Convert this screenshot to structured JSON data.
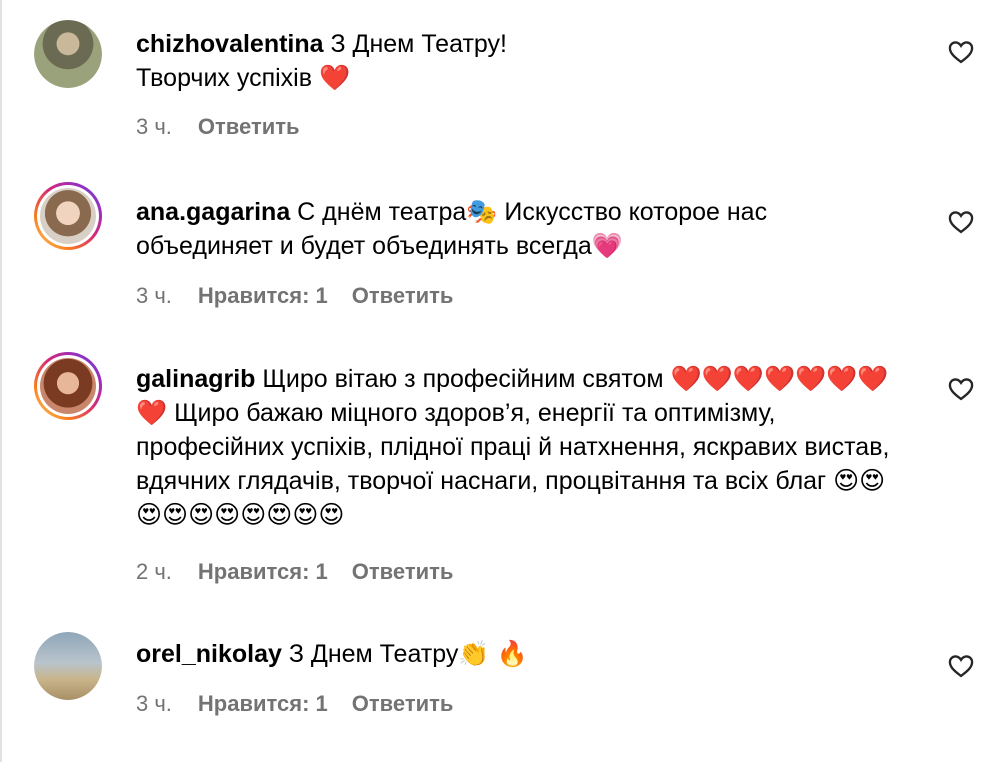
{
  "comments": [
    {
      "username": "chizhovalentina",
      "text": " З Днем Театру!\nТворчих успіхів ❤️",
      "time": "3 ч.",
      "likes": "",
      "reply": "Ответить",
      "avatar_ring": false
    },
    {
      "username": "ana.gagarina",
      "text": " С днём театра🎭 Искусство которое нас объединяет и будет объединять всегда💗",
      "time": "3 ч.",
      "likes": "Нравится: 1",
      "reply": "Ответить",
      "avatar_ring": true
    },
    {
      "username": "galinagrib",
      "text": " Щиро вітаю з професійним святом ❤️❤️❤️❤️❤️❤️❤️❤️ Щиро бажаю міцного здоров’я, енергії та оптимізму, професійних успіхів, плідної праці й натхнення, яскравих вистав, вдячних глядачів, творчої наснаги, процвітання та всіх благ 😍😍😍😍😍😍😍😍😍😍",
      "time": "2 ч.",
      "likes": "Нравится: 1",
      "reply": "Ответить",
      "avatar_ring": true
    },
    {
      "username": "orel_nikolay",
      "text": " З Днем Театру👏 🔥",
      "time": "3 ч.",
      "likes": "Нравится: 1",
      "reply": "Ответить",
      "avatar_ring": false
    }
  ],
  "icons": {
    "like": "heart-outline-icon"
  },
  "colors": {
    "meta_text": "#737373",
    "divider": "#e2e2e2"
  }
}
